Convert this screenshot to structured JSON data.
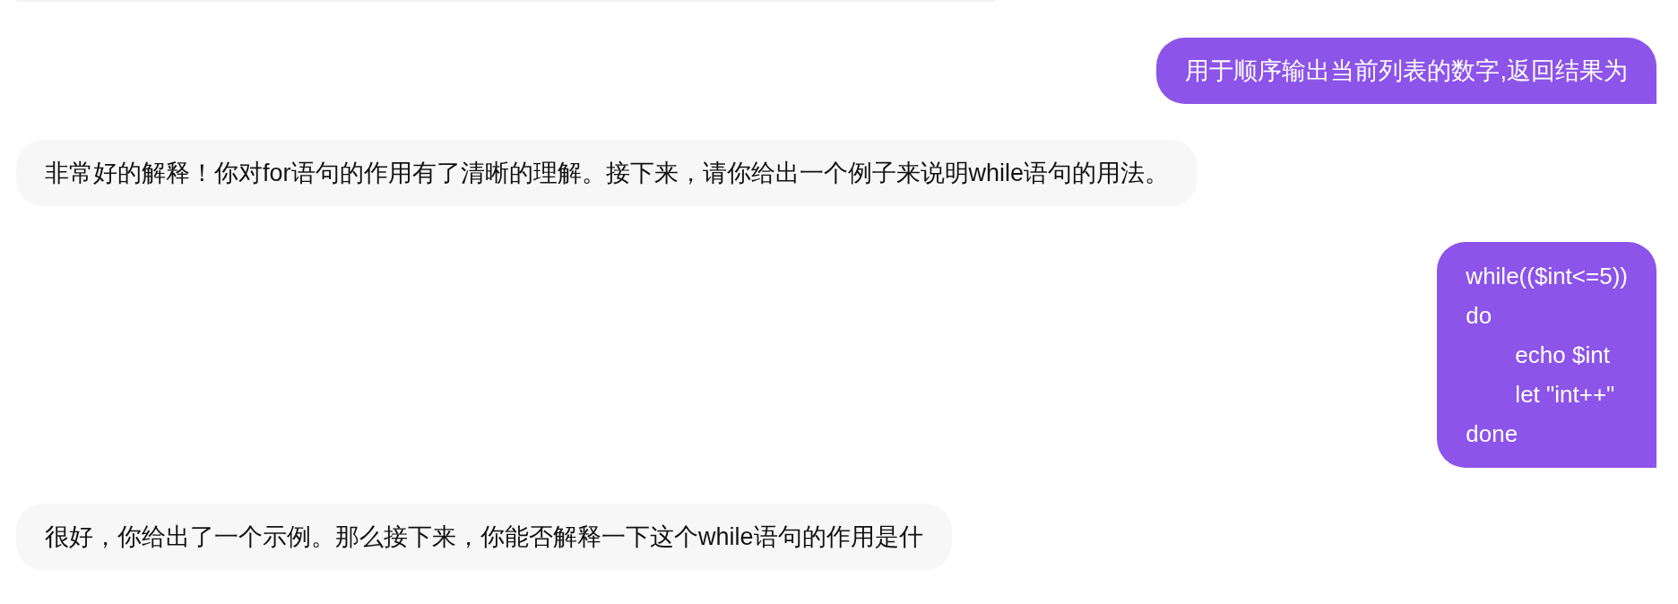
{
  "messages": [
    {
      "kind": "user",
      "text": "用于顺序输出当前列表的数字,返回结果为"
    },
    {
      "kind": "bot",
      "text": "非常好的解释！你对for语句的作用有了清晰的理解。接下来，请你给出一个例子来说明while语句的用法。"
    },
    {
      "kind": "code",
      "lines": [
        {
          "text": "while(($int<=5))",
          "indented": false
        },
        {
          "text": "do",
          "indented": false
        },
        {
          "text": "echo $int",
          "indented": true
        },
        {
          "text": "let \"int++\"",
          "indented": true
        },
        {
          "text": "done",
          "indented": false
        }
      ]
    },
    {
      "kind": "bot",
      "text": "很好，你给出了一个示例。那么接下来，你能否解释一下这个while语句的作用是什"
    }
  ]
}
